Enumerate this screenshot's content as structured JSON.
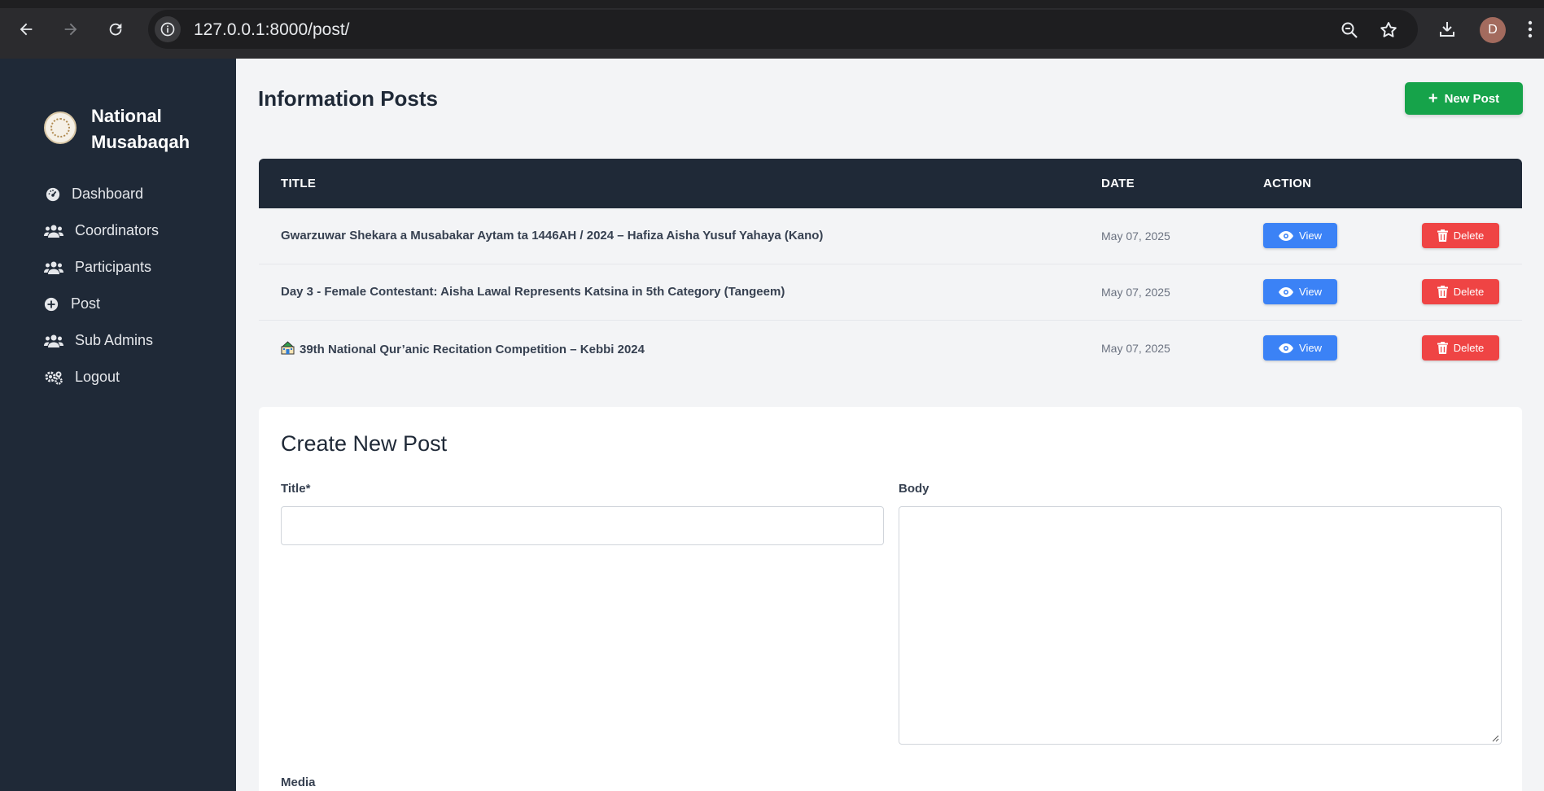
{
  "browser": {
    "url": "127.0.0.1:8000/post/",
    "avatar_letter": "D"
  },
  "sidebar": {
    "brand": "National Musabaqah",
    "items": [
      {
        "label": "Dashboard",
        "icon": "gauge-icon"
      },
      {
        "label": "Coordinators",
        "icon": "users-icon"
      },
      {
        "label": "Participants",
        "icon": "users-icon"
      },
      {
        "label": "Post",
        "icon": "plus-circle-icon"
      },
      {
        "label": "Sub Admins",
        "icon": "users-icon"
      },
      {
        "label": "Logout",
        "icon": "gears-icon"
      }
    ]
  },
  "main": {
    "title": "Information Posts",
    "new_post_label": "New Post",
    "table": {
      "headers": {
        "title": "TITLE",
        "date": "DATE",
        "action": "ACTION"
      },
      "rows": [
        {
          "title": "Gwarzuwar Shekara a Musabakar Aytam ta 1446AH / 2024 – Hafiza Aisha Yusuf Yahaya (Kano)",
          "date": "May 07, 2025",
          "view": "View",
          "delete": "Delete"
        },
        {
          "title": "Day 3 - Female Contestant: Aisha Lawal Represents Katsina in 5th Category (Tangeem)",
          "date": "May 07, 2025",
          "view": "View",
          "delete": "Delete"
        },
        {
          "title": "39th National Qur’anic Recitation Competition – Kebbi 2024",
          "date": "May 07, 2025",
          "view": "View",
          "delete": "Delete"
        }
      ]
    },
    "form": {
      "title": "Create New Post",
      "title_label": "Title*",
      "title_value": "",
      "body_label": "Body",
      "body_value": "",
      "media_label": "Media"
    }
  },
  "colors": {
    "sidebar_bg": "#1f2937",
    "new_post": "#16a34a",
    "view": "#3b82f6",
    "delete": "#ef4444"
  }
}
